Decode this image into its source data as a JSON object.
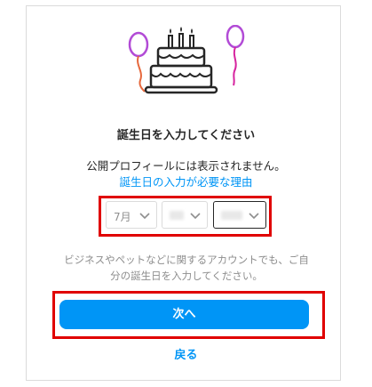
{
  "heading": {
    "title": "誕生日を入力してください",
    "subtitle": "公開プロフィールには表示されません。",
    "why_link": "誕生日の入力が必要な理由"
  },
  "birthday": {
    "month_value": "7月",
    "day_value": "",
    "year_value": ""
  },
  "note": {
    "line1": "ビジネスやペットなどに関するアカウントでも、ご自",
    "line2": "分の誕生日を入力してください。"
  },
  "actions": {
    "next_label": "次へ",
    "back_label": "戻る"
  },
  "colors": {
    "accent": "#0095f6",
    "highlight": "#e00000",
    "text": "#262626",
    "muted": "#8e8e8e"
  },
  "icons": {
    "illustration": "birthday-cake-with-balloons-icon",
    "dropdown": "chevron-down-icon"
  }
}
